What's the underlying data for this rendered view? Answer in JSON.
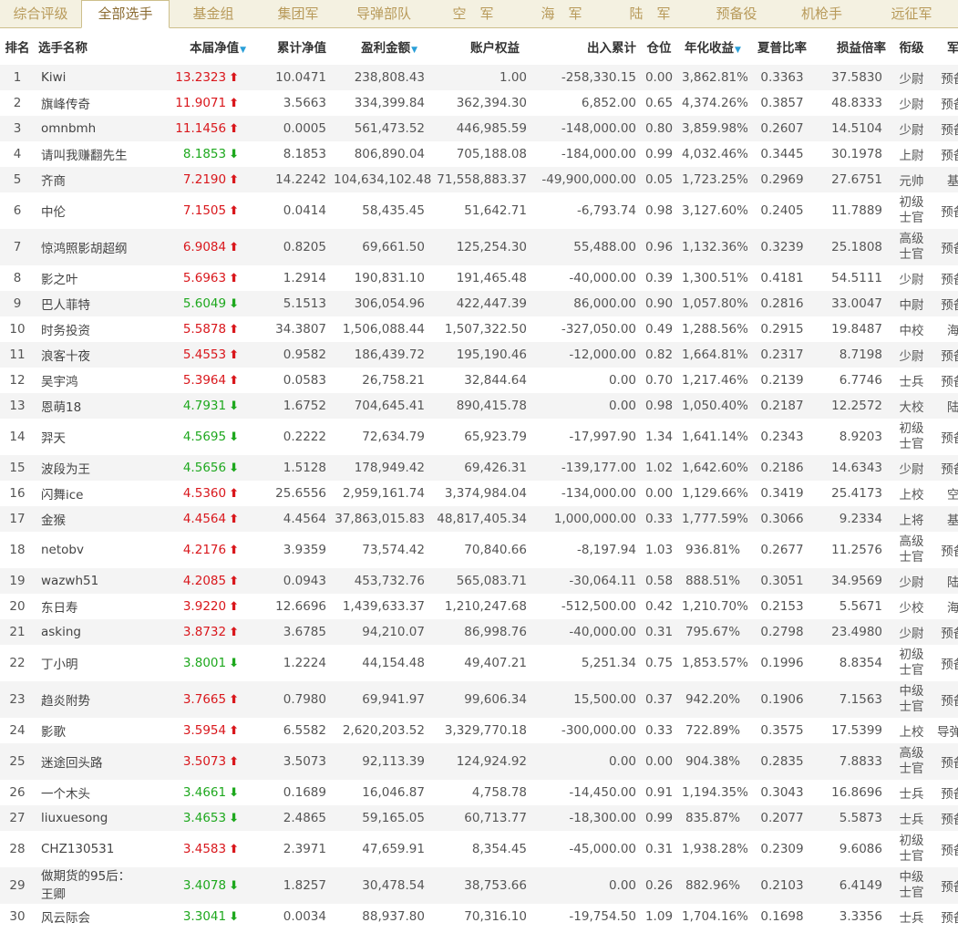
{
  "tabs": [
    {
      "label": "综合评级",
      "width": 89,
      "active": false
    },
    {
      "label": "全部选手",
      "width": 97,
      "active": true
    },
    {
      "label": "基金组",
      "width": 96,
      "active": false
    },
    {
      "label": "集团军",
      "width": 90,
      "active": false
    },
    {
      "label": "导弹部队",
      "width": 98,
      "active": false
    },
    {
      "label": "空　军",
      "width": 98,
      "active": false
    },
    {
      "label": "海　军",
      "width": 96,
      "active": false
    },
    {
      "label": "陆　军",
      "width": 98,
      "active": false
    },
    {
      "label": "预备役",
      "width": 92,
      "active": false
    },
    {
      "label": "机枪手",
      "width": 95,
      "active": false
    },
    {
      "label": "远征军",
      "width": 102,
      "active": false
    }
  ],
  "columns": [
    "排名",
    "选手名称",
    "本届净值",
    "累计净值",
    "盈利金额",
    "账户权益",
    "出入累计",
    "仓位",
    "年化收益",
    "夏普比率",
    "损益倍率",
    "衔级",
    "军种"
  ],
  "sort_indicator": "▼",
  "rows": [
    {
      "rank": "1",
      "name": "Kiwi",
      "net": "13.2323",
      "trend": "up",
      "cum": "10.0471",
      "profit": "238,808.43",
      "equity": "1.00",
      "flow": "-258,330.15",
      "pos": "0.00",
      "annual": "3,862.81%",
      "sharpe": "0.3363",
      "pl": "37.5830",
      "rank_title": "少尉",
      "branch": "预备役"
    },
    {
      "rank": "2",
      "name": "旗峰传奇",
      "net": "11.9071",
      "trend": "up",
      "cum": "3.5663",
      "profit": "334,399.84",
      "equity": "362,394.30",
      "flow": "6,852.00",
      "pos": "0.65",
      "annual": "4,374.26%",
      "sharpe": "0.3857",
      "pl": "48.8333",
      "rank_title": "少尉",
      "branch": "预备役"
    },
    {
      "rank": "3",
      "name": "omnbmh",
      "net": "11.1456",
      "trend": "up",
      "cum": "0.0005",
      "profit": "561,473.52",
      "equity": "446,985.59",
      "flow": "-148,000.00",
      "pos": "0.80",
      "annual": "3,859.98%",
      "sharpe": "0.2607",
      "pl": "14.5104",
      "rank_title": "少尉",
      "branch": "预备役"
    },
    {
      "rank": "4",
      "name": "请叫我赚翻先生",
      "net": "8.1853",
      "trend": "down",
      "cum": "8.1853",
      "profit": "806,890.04",
      "equity": "705,188.08",
      "flow": "-184,000.00",
      "pos": "0.99",
      "annual": "4,032.46%",
      "sharpe": "0.3445",
      "pl": "30.1978",
      "rank_title": "上尉",
      "branch": "预备役"
    },
    {
      "rank": "5",
      "name": "齐商",
      "net": "7.2190",
      "trend": "up",
      "cum": "14.2242",
      "profit": "104,634,102.48",
      "equity": "71,558,883.37",
      "flow": "-49,900,000.00",
      "pos": "0.05",
      "annual": "1,723.25%",
      "sharpe": "0.2969",
      "pl": "27.6751",
      "rank_title": "元帅",
      "branch": "基金"
    },
    {
      "rank": "6",
      "name": "中伦",
      "net": "7.1505",
      "trend": "up",
      "cum": "0.0414",
      "profit": "58,435.45",
      "equity": "51,642.71",
      "flow": "-6,793.74",
      "pos": "0.98",
      "annual": "3,127.60%",
      "sharpe": "0.2405",
      "pl": "11.7889",
      "rank_title": "初级士官",
      "branch": "预备役"
    },
    {
      "rank": "7",
      "name": "惊鸿照影胡超纲",
      "net": "6.9084",
      "trend": "up",
      "cum": "0.8205",
      "profit": "69,661.50",
      "equity": "125,254.30",
      "flow": "55,488.00",
      "pos": "0.96",
      "annual": "1,132.36%",
      "sharpe": "0.3239",
      "pl": "25.1808",
      "rank_title": "高级士官",
      "branch": "预备役"
    },
    {
      "rank": "8",
      "name": "影之叶",
      "net": "5.6963",
      "trend": "up",
      "cum": "1.2914",
      "profit": "190,831.10",
      "equity": "191,465.48",
      "flow": "-40,000.00",
      "pos": "0.39",
      "annual": "1,300.51%",
      "sharpe": "0.4181",
      "pl": "54.5111",
      "rank_title": "少尉",
      "branch": "预备役"
    },
    {
      "rank": "9",
      "name": "巴人菲特",
      "net": "5.6049",
      "trend": "down",
      "cum": "5.1513",
      "profit": "306,054.96",
      "equity": "422,447.39",
      "flow": "86,000.00",
      "pos": "0.90",
      "annual": "1,057.80%",
      "sharpe": "0.2816",
      "pl": "33.0047",
      "rank_title": "中尉",
      "branch": "预备役"
    },
    {
      "rank": "10",
      "name": "时务投资",
      "net": "5.5878",
      "trend": "up",
      "cum": "34.3807",
      "profit": "1,506,088.44",
      "equity": "1,507,322.50",
      "flow": "-327,050.00",
      "pos": "0.49",
      "annual": "1,288.56%",
      "sharpe": "0.2915",
      "pl": "19.8487",
      "rank_title": "中校",
      "branch": "海军"
    },
    {
      "rank": "11",
      "name": "浪客十夜",
      "net": "5.4553",
      "trend": "up",
      "cum": "0.9582",
      "profit": "186,439.72",
      "equity": "195,190.46",
      "flow": "-12,000.00",
      "pos": "0.82",
      "annual": "1,664.81%",
      "sharpe": "0.2317",
      "pl": "8.7198",
      "rank_title": "少尉",
      "branch": "预备役"
    },
    {
      "rank": "12",
      "name": "吴宇鸿",
      "net": "5.3964",
      "trend": "up",
      "cum": "0.0583",
      "profit": "26,758.21",
      "equity": "32,844.64",
      "flow": "0.00",
      "pos": "0.70",
      "annual": "1,217.46%",
      "sharpe": "0.2139",
      "pl": "6.7746",
      "rank_title": "士兵",
      "branch": "预备役"
    },
    {
      "rank": "13",
      "name": "恩萌18",
      "net": "4.7931",
      "trend": "down",
      "cum": "1.6752",
      "profit": "704,645.41",
      "equity": "890,415.78",
      "flow": "0.00",
      "pos": "0.98",
      "annual": "1,050.40%",
      "sharpe": "0.2187",
      "pl": "12.2572",
      "rank_title": "大校",
      "branch": "陆军"
    },
    {
      "rank": "14",
      "name": "羿天",
      "net": "4.5695",
      "trend": "down",
      "cum": "0.2222",
      "profit": "72,634.79",
      "equity": "65,923.79",
      "flow": "-17,997.90",
      "pos": "1.34",
      "annual": "1,641.14%",
      "sharpe": "0.2343",
      "pl": "8.9203",
      "rank_title": "初级士官",
      "branch": "预备役"
    },
    {
      "rank": "15",
      "name": "波段为王",
      "net": "4.5656",
      "trend": "down",
      "cum": "1.5128",
      "profit": "178,949.42",
      "equity": "69,426.31",
      "flow": "-139,177.00",
      "pos": "1.02",
      "annual": "1,642.60%",
      "sharpe": "0.2186",
      "pl": "14.6343",
      "rank_title": "少尉",
      "branch": "预备役"
    },
    {
      "rank": "16",
      "name": "闪舞ice",
      "net": "4.5360",
      "trend": "up",
      "cum": "25.6556",
      "profit": "2,959,161.74",
      "equity": "3,374,984.04",
      "flow": "-134,000.00",
      "pos": "0.00",
      "annual": "1,129.66%",
      "sharpe": "0.3419",
      "pl": "25.4173",
      "rank_title": "上校",
      "branch": "空军"
    },
    {
      "rank": "17",
      "name": "金猴",
      "net": "4.4564",
      "trend": "up",
      "cum": "4.4564",
      "profit": "37,863,015.83",
      "equity": "48,817,405.34",
      "flow": "1,000,000.00",
      "pos": "0.33",
      "annual": "1,777.59%",
      "sharpe": "0.3066",
      "pl": "9.2334",
      "rank_title": "上将",
      "branch": "基金"
    },
    {
      "rank": "18",
      "name": "netobv",
      "net": "4.2176",
      "trend": "up",
      "cum": "3.9359",
      "profit": "73,574.42",
      "equity": "70,840.66",
      "flow": "-8,197.94",
      "pos": "1.03",
      "annual": "936.81%",
      "sharpe": "0.2677",
      "pl": "11.2576",
      "rank_title": "高级士官",
      "branch": "预备役"
    },
    {
      "rank": "19",
      "name": "wazwh51",
      "net": "4.2085",
      "trend": "up",
      "cum": "0.0943",
      "profit": "453,732.76",
      "equity": "565,083.71",
      "flow": "-30,064.11",
      "pos": "0.58",
      "annual": "888.51%",
      "sharpe": "0.3051",
      "pl": "34.9569",
      "rank_title": "少尉",
      "branch": "陆军"
    },
    {
      "rank": "20",
      "name": "东日寿",
      "net": "3.9220",
      "trend": "up",
      "cum": "12.6696",
      "profit": "1,439,633.37",
      "equity": "1,210,247.68",
      "flow": "-512,500.00",
      "pos": "0.42",
      "annual": "1,210.70%",
      "sharpe": "0.2153",
      "pl": "5.5671",
      "rank_title": "少校",
      "branch": "海军"
    },
    {
      "rank": "21",
      "name": "asking",
      "net": "3.8732",
      "trend": "up",
      "cum": "3.6785",
      "profit": "94,210.07",
      "equity": "86,998.76",
      "flow": "-40,000.00",
      "pos": "0.31",
      "annual": "795.67%",
      "sharpe": "0.2798",
      "pl": "23.4980",
      "rank_title": "少尉",
      "branch": "预备役"
    },
    {
      "rank": "22",
      "name": "丁小明",
      "net": "3.8001",
      "trend": "down",
      "cum": "1.2224",
      "profit": "44,154.48",
      "equity": "49,407.21",
      "flow": "5,251.34",
      "pos": "0.75",
      "annual": "1,853.57%",
      "sharpe": "0.1996",
      "pl": "8.8354",
      "rank_title": "初级士官",
      "branch": "预备役"
    },
    {
      "rank": "23",
      "name": "趋炎附势",
      "net": "3.7665",
      "trend": "up",
      "cum": "0.7980",
      "profit": "69,941.97",
      "equity": "99,606.34",
      "flow": "15,500.00",
      "pos": "0.37",
      "annual": "942.20%",
      "sharpe": "0.1906",
      "pl": "7.1563",
      "rank_title": "中级士官",
      "branch": "预备役"
    },
    {
      "rank": "24",
      "name": "影歌",
      "net": "3.5954",
      "trend": "up",
      "cum": "6.5582",
      "profit": "2,620,203.52",
      "equity": "3,329,770.18",
      "flow": "-300,000.00",
      "pos": "0.33",
      "annual": "722.89%",
      "sharpe": "0.3575",
      "pl": "17.5399",
      "rank_title": "上校",
      "branch": "导弹部队"
    },
    {
      "rank": "25",
      "name": "迷途回头路",
      "net": "3.5073",
      "trend": "up",
      "cum": "3.5073",
      "profit": "92,113.39",
      "equity": "124,924.92",
      "flow": "0.00",
      "pos": "0.00",
      "annual": "904.38%",
      "sharpe": "0.2835",
      "pl": "7.8833",
      "rank_title": "高级士官",
      "branch": "预备役"
    },
    {
      "rank": "26",
      "name": "一个木头",
      "net": "3.4661",
      "trend": "down",
      "cum": "0.1689",
      "profit": "16,046.87",
      "equity": "4,758.78",
      "flow": "-14,450.00",
      "pos": "0.91",
      "annual": "1,194.35%",
      "sharpe": "0.3043",
      "pl": "16.8696",
      "rank_title": "士兵",
      "branch": "预备役"
    },
    {
      "rank": "27",
      "name": "liuxuesong",
      "net": "3.4653",
      "trend": "down",
      "cum": "2.4865",
      "profit": "59,165.05",
      "equity": "60,713.77",
      "flow": "-18,300.00",
      "pos": "0.99",
      "annual": "835.87%",
      "sharpe": "0.2077",
      "pl": "5.5873",
      "rank_title": "士兵",
      "branch": "预备役"
    },
    {
      "rank": "28",
      "name": "CHZ130531",
      "net": "3.4583",
      "trend": "up",
      "cum": "2.3971",
      "profit": "47,659.91",
      "equity": "8,354.45",
      "flow": "-45,000.00",
      "pos": "0.31",
      "annual": "1,938.28%",
      "sharpe": "0.2309",
      "pl": "9.6086",
      "rank_title": "初级士官",
      "branch": "预备役"
    },
    {
      "rank": "29",
      "name": "做期货的95后：王卿",
      "net": "3.4078",
      "trend": "down",
      "cum": "1.8257",
      "profit": "30,478.54",
      "equity": "38,753.66",
      "flow": "0.00",
      "pos": "0.26",
      "annual": "882.96%",
      "sharpe": "0.2103",
      "pl": "6.4149",
      "rank_title": "中级士官",
      "branch": "预备役"
    },
    {
      "rank": "30",
      "name": "风云际会",
      "net": "3.3041",
      "trend": "down",
      "cum": "0.0034",
      "profit": "88,937.80",
      "equity": "70,316.10",
      "flow": "-19,754.50",
      "pos": "1.09",
      "annual": "1,704.16%",
      "sharpe": "0.1698",
      "pl": "3.3356",
      "rank_title": "士兵",
      "branch": "预备役"
    }
  ]
}
